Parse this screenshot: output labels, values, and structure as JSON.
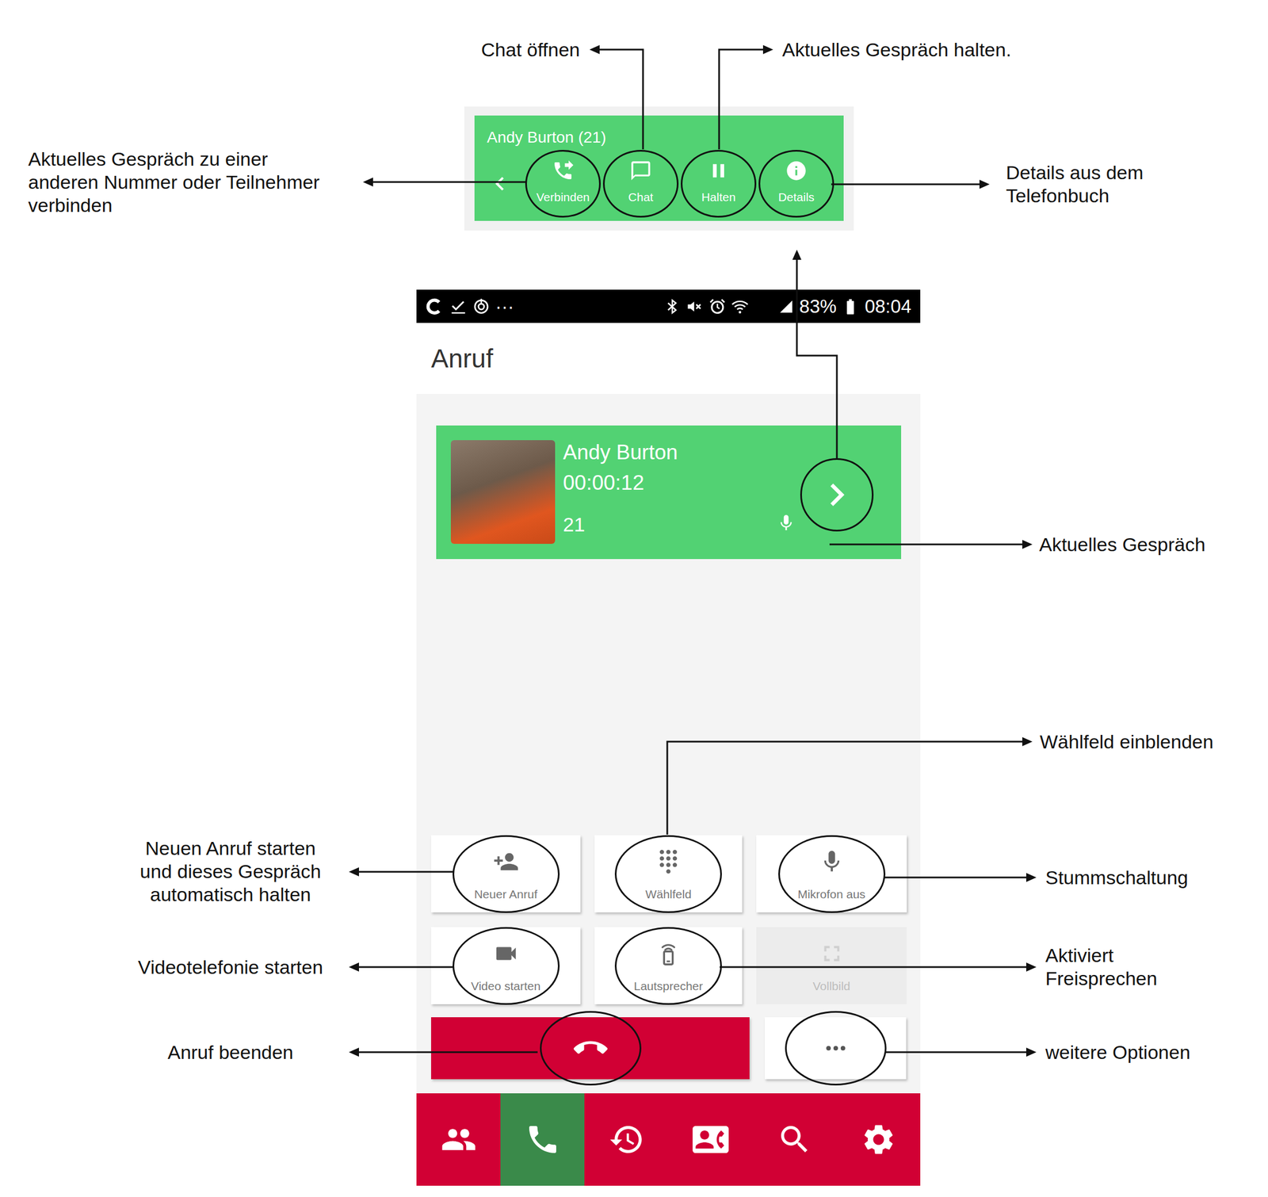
{
  "popup": {
    "title": "Andy Burton (21)",
    "buttons": [
      {
        "label": "Verbinden",
        "kind": "transfer"
      },
      {
        "label": "Chat",
        "kind": "chat"
      },
      {
        "label": "Halten",
        "kind": "hold"
      },
      {
        "label": "Details",
        "kind": "info"
      }
    ]
  },
  "status_bar": {
    "more": "···",
    "battery": "83%",
    "time": "08:04"
  },
  "screen_title": "Anruf",
  "call": {
    "name": "Andy Burton",
    "duration": "00:00:12",
    "number": "21",
    "active": true
  },
  "controls": [
    {
      "label": "Neuer Anruf",
      "kind": "add-call",
      "disabled": false
    },
    {
      "label": "Wählfeld",
      "kind": "dialpad",
      "disabled": false
    },
    {
      "label": "Mikrofon aus",
      "kind": "mute",
      "disabled": false
    },
    {
      "label": "Video starten",
      "kind": "video",
      "disabled": false
    },
    {
      "label": "Lautsprecher",
      "kind": "speaker",
      "disabled": false
    },
    {
      "label": "Vollbild",
      "kind": "fullscreen",
      "disabled": true
    }
  ],
  "nav": [
    {
      "kind": "contacts",
      "selected": false
    },
    {
      "kind": "call",
      "selected": true
    },
    {
      "kind": "history",
      "selected": false
    },
    {
      "kind": "phonebook",
      "selected": false
    },
    {
      "kind": "search",
      "selected": false
    },
    {
      "kind": "settings",
      "selected": false
    }
  ],
  "annotations": [
    {
      "lines": [
        "Chat öffnen"
      ]
    },
    {
      "lines": [
        "Aktuelles Gespräch halten."
      ]
    },
    {
      "lines": [
        "Aktuelles Gespräch zu einer",
        "anderen Nummer oder Teilnehmer",
        "verbinden"
      ]
    },
    {
      "lines": [
        "Details aus dem",
        "Telefonbuch"
      ]
    },
    {
      "lines": [
        "Aktuelles Gespräch"
      ]
    },
    {
      "lines": [
        "Wählfeld einblenden"
      ]
    },
    {
      "lines": [
        "Stummschaltung"
      ]
    },
    {
      "lines": [
        "Aktiviert",
        "Freisprechen"
      ]
    },
    {
      "lines": [
        "weitere Optionen"
      ]
    },
    {
      "lines": [
        "Neuen Anruf starten",
        "und dieses Gespräch",
        "automatisch halten"
      ]
    },
    {
      "lines": [
        "Videotelefonie starten"
      ]
    },
    {
      "lines": [
        "Anruf beenden"
      ]
    }
  ]
}
